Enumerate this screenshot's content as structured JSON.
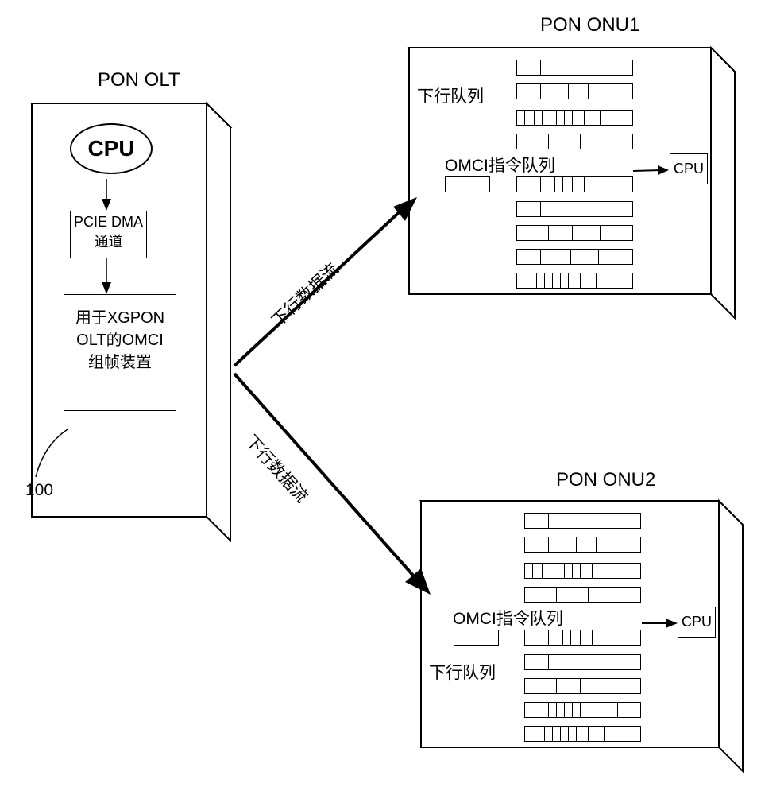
{
  "olt": {
    "title": "PON OLT",
    "cpu": "CPU",
    "pcie": "PCIE DMA\n通道",
    "omci_device": "用于XGPON\nOLT的OMCI\n组帧装置",
    "ref": "100"
  },
  "onu1": {
    "title": "PON ONU1",
    "queue_label": "下行队列",
    "omci_label": "OMCI指令队列",
    "cpu": "CPU"
  },
  "onu2": {
    "title": "PON ONU2",
    "queue_label": "下行队列",
    "omci_label": "OMCI指令队列",
    "cpu": "CPU"
  },
  "flows": {
    "to_onu1": "下行数据流",
    "to_onu2": "下行数据流"
  }
}
